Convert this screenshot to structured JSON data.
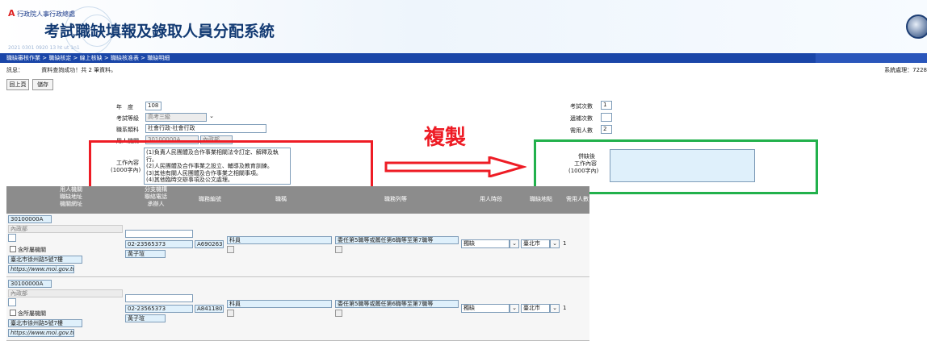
{
  "header": {
    "org": "行政院人事行政總處",
    "title": "考試職缺填報及錄取人員分配系統",
    "subline": "2021 0301 0920 13 ht ut 1n1"
  },
  "nav": {
    "breadcrumb": "職缺審核作業 > 職缺核定 > 線上核缺 > 職缺核准表 > 職缺明細"
  },
  "msg": {
    "label": "訊息：",
    "text": "資料查詢成功！共 2 筆資料。",
    "right": "系統處理：7228"
  },
  "buttons": {
    "back": "回上頁",
    "save": "儲存"
  },
  "form": {
    "year_label": "年　度",
    "year": "108",
    "level_label": "考試等級",
    "level": "高考三級",
    "category_label": "職系類科",
    "category": "社會行政-社會行政",
    "agency_label": "用人機關",
    "agency": "30100000A",
    "agency2": "內政部",
    "work_label": "工作內容",
    "work_sub": "(1000字內)",
    "work_text": "(1)負責人民團體及合作事業相關法令訂定、解釋及執行。\n(2)人民團體及合作事業之設立、輔導及教育訓練。\n(3)其他有關人民團體及合作事業之相關事項。\n(4)其他臨時交辦事項及公文處理。",
    "exam_times_label": "考試次數",
    "exam_times": "1",
    "transfer_label": "遞補次數",
    "transfer": "",
    "need_label": "需用人數",
    "need": "2"
  },
  "annotation": {
    "copy": "複製"
  },
  "target": {
    "label1": "併缺後",
    "label2": "工作內容",
    "label3": "(1000字內)"
  },
  "table": {
    "headers": [
      "用人機關\n職缺地址\n機關網址",
      "分支機構\n聯絡電話\n承辦人",
      "職務編號",
      "職稱",
      "職務列等",
      "用人時段",
      "職缺地點",
      "需用人數"
    ],
    "rows": [
      {
        "code": "30100000A",
        "name": "內政部",
        "branch": "",
        "chk": "含所屬機關",
        "address": "臺北市徐州路5號7樓",
        "url": "https://www.moi.gov.tw/",
        "phone": "02-23565373",
        "contact": "黃子瑄",
        "post_no": "A690263",
        "title": "科員",
        "rank": "委任第5職等或薦任第6職等至第7職等",
        "period": "獨缺",
        "location": "臺北市",
        "count": "1"
      },
      {
        "code": "30100000A",
        "name": "內政部",
        "branch": "",
        "chk": "含所屬機關",
        "address": "臺北市徐州路5號7樓",
        "url": "https://www.moi.gov.tw/",
        "phone": "02-23565373",
        "contact": "黃子瑄",
        "post_no": "A841180",
        "title": "科員",
        "rank": "委任第5職等或薦任第6職等至第7職等",
        "period": "獨缺",
        "location": "臺北市",
        "count": "1"
      }
    ]
  },
  "colors": {
    "nav": "#1a46a8",
    "red": "#ee1c25",
    "green": "#22b14c",
    "field_blue": "#dff0fb"
  }
}
